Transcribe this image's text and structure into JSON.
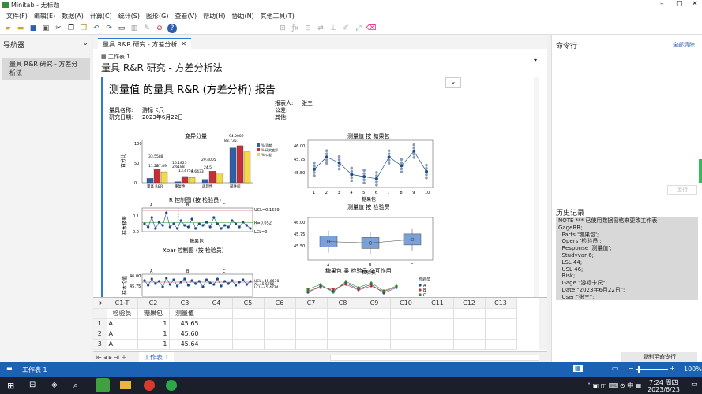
{
  "window": {
    "title": "Minitab - 无标题"
  },
  "menu": [
    "文件(F)",
    "编辑(E)",
    "数据(A)",
    "计算(C)",
    "统计(S)",
    "图形(G)",
    "查看(V)",
    "帮助(H)",
    "协助(N)",
    "其他工具(T)"
  ],
  "navigator": {
    "title": "导航器",
    "item": "量具 R&R 研究 - 方差分析法"
  },
  "tab": {
    "label": "量具 R&R 研究 - 方差分析法"
  },
  "worksheet_label": "工作表 1",
  "output_title": "量具 R&R 研究 - 方差分析法",
  "report": {
    "title": "测量值 的量具 R&R (方差分析) 报告",
    "gauge_name_label": "量具名称:",
    "gauge_name": "游标卡尺",
    "date_label": "研究日期:",
    "date": "2023年6月22日",
    "reporter_label": "报表人:",
    "reporter": "张三",
    "tolerance_label": "公差:",
    "misc_label": "其他:"
  },
  "chart_data": [
    {
      "type": "bar",
      "title": "变异分量",
      "ylabel": "百分比",
      "categories": [
        "量具 R&R",
        "重复性",
        "再现性",
        "部件间"
      ],
      "series": [
        {
          "name": "% 贡献",
          "values": [
            11.26,
            2.61,
            8.64,
            88.74
          ]
        },
        {
          "name": "% 研究变异",
          "values": [
            33.56,
            16.18,
            29.41,
            94.2
          ]
        },
        {
          "name": "% 公差",
          "values": [
            27.89,
            13.48,
            24.51,
            78.5
          ]
        }
      ],
      "labels": [
        "11.26",
        "33.5588",
        "27.89",
        "2.6188",
        "16.1825",
        "13.4753",
        "8.6433",
        "29.4005",
        "24.5",
        "88.7357",
        "94.2009"
      ],
      "ylim": [
        0,
        100
      ],
      "yticks": [
        "0",
        "50",
        "100"
      ]
    },
    {
      "type": "line",
      "title": "R 控制图 (按 检验员)",
      "xlabel": "糖果包",
      "ylabel": "样本极差",
      "ucl_label": "UCL=0.1539",
      "rbar_label": "R=0.052",
      "lcl_label": "LCL=0",
      "groups": [
        "A",
        "B",
        "C"
      ],
      "ylim": [
        0,
        0.15
      ],
      "yticks": [
        "0.0",
        "0.1"
      ]
    },
    {
      "type": "line",
      "title": "Xbar 控制图 (按 检验员)",
      "ylabel": "样本均值",
      "ucl_label": "UCL=45.6678",
      "mean_label": "X=45.5756",
      "lcl_label": "LCL=45.4734",
      "groups": [
        "A",
        "B",
        "C"
      ],
      "yticks": [
        "46.00",
        "45.75"
      ]
    },
    {
      "type": "scatter",
      "title": "测量值 按 糖果包",
      "xlabel": "糖果包",
      "categories": [
        "1",
        "2",
        "3",
        "4",
        "5",
        "6",
        "7",
        "8",
        "9",
        "10"
      ],
      "means": [
        45.65,
        45.82,
        45.74,
        45.58,
        45.55,
        45.52,
        45.82,
        45.7,
        45.9,
        45.62
      ],
      "ylim": [
        45.4,
        46.05
      ],
      "yticks": [
        "46.00",
        "45.75",
        "45.50"
      ]
    },
    {
      "type": "box",
      "title": "测量值 按 检验员",
      "xlabel": "检验员",
      "categories": [
        "A",
        "B",
        "C"
      ],
      "medians": [
        45.71,
        45.69,
        45.74
      ],
      "ylim": [
        45.45,
        46.05
      ],
      "yticks": [
        "46.00",
        "45.75",
        "45.50"
      ]
    },
    {
      "type": "line",
      "title": "糖果包 乘 检验员 交互作用",
      "legend_title": "检验员",
      "legend": [
        "A",
        "B",
        "C"
      ]
    }
  ],
  "grid": {
    "cols": [
      "C1-T",
      "C2",
      "C3",
      "C4",
      "C5",
      "C6",
      "C7",
      "C8",
      "C9",
      "C10",
      "C11",
      "C12",
      "C13"
    ],
    "names": [
      "检验员",
      "糖果包",
      "测量值"
    ],
    "rows": [
      [
        "1",
        "A",
        "1",
        "45.65"
      ],
      [
        "2",
        "A",
        "1",
        "45.60"
      ],
      [
        "3",
        "A",
        "1",
        "45.64"
      ]
    ],
    "sheet_tab": "工作表 1"
  },
  "command_pane": {
    "title": "命令行",
    "clear": "全部清除",
    "run": "运行"
  },
  "history": {
    "title": "历史记录",
    "lines": [
      "NOTE *** 已使用数据窗格来更改工作表",
      "GageRR;",
      "  Parts '糖果包';",
      "  Opers '检验员';",
      "  Response '测量值';",
      "  Studyvar 6;",
      "  LSL 44;",
      "  USL 46;",
      "  Risk;",
      "  Gage \"游标卡尺\";",
      "  Date \"2023年6月22日\";",
      "  User \"张三\";"
    ],
    "button": "复制至命令行"
  },
  "status": {
    "sheet": "工作表 1",
    "zoom": "100%"
  },
  "taskbar": {
    "time": "7:24 周四",
    "date": "2023/6/23"
  }
}
